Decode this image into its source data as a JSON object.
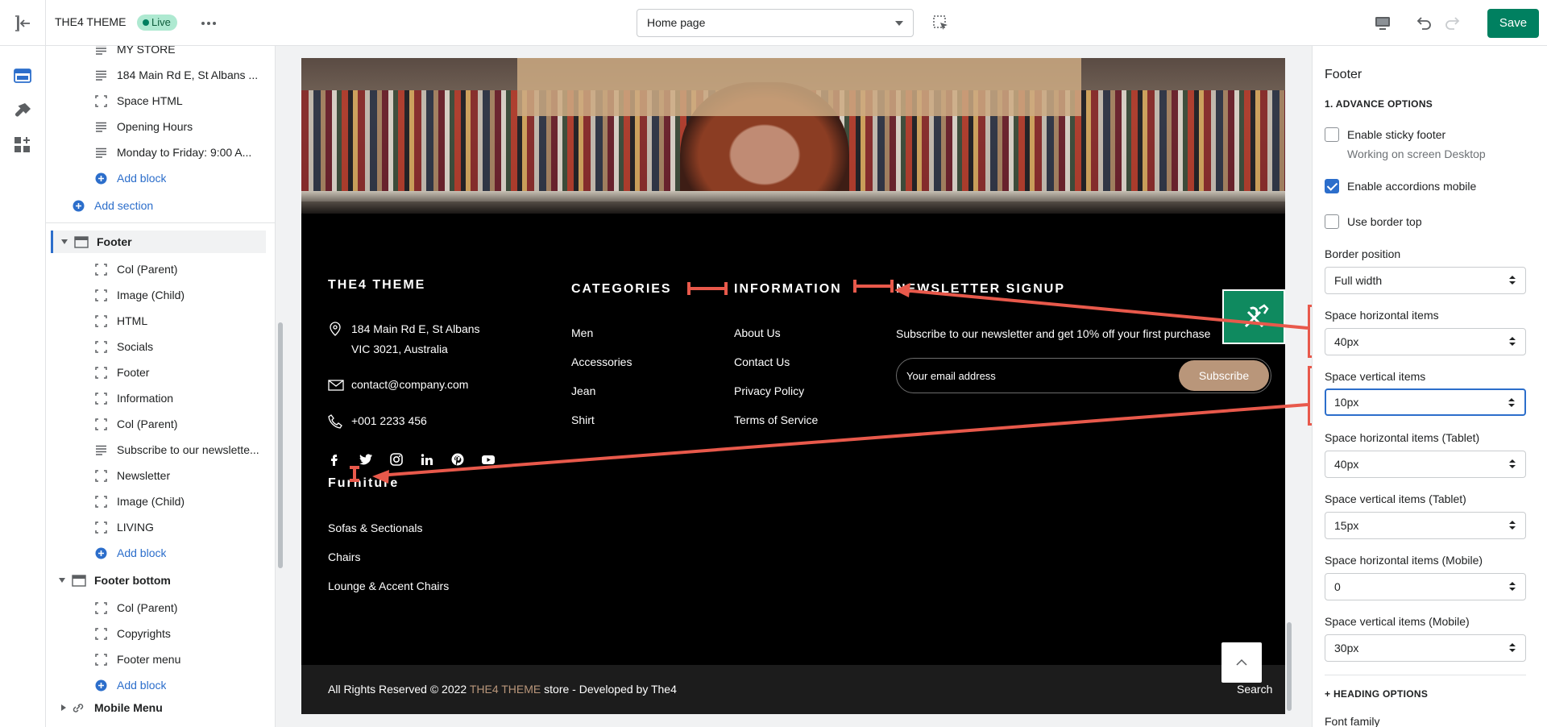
{
  "topbar": {
    "theme_name": "THE4 THEME",
    "live_badge": "Live",
    "page_select": "Home page",
    "save_label": "Save"
  },
  "sidebar": {
    "items": [
      {
        "label": "MY STORE",
        "icon": "text-lines-icon"
      },
      {
        "label": "184 Main Rd E, St Albans ...",
        "icon": "text-lines-icon"
      },
      {
        "label": "Space HTML",
        "icon": "block-frame-icon"
      },
      {
        "label": "Opening Hours",
        "icon": "text-lines-icon"
      },
      {
        "label": "Monday to Friday: 9:00 A...",
        "icon": "text-lines-icon"
      }
    ],
    "add_block": "Add block",
    "add_section": "Add section",
    "footer_section": "Footer",
    "footer_items": [
      "Col (Parent)",
      "Image (Child)",
      "HTML",
      "Socials",
      "Footer",
      "Information",
      "Col (Parent)",
      "Subscribe to our newslette...",
      "Newsletter",
      "Image (Child)",
      "LIVING"
    ],
    "footer_items_icons": [
      "block-frame-icon",
      "block-frame-icon",
      "block-frame-icon",
      "block-frame-icon",
      "block-frame-icon",
      "block-frame-icon",
      "block-frame-icon",
      "text-lines-icon",
      "block-frame-icon",
      "block-frame-icon",
      "block-frame-icon"
    ],
    "footer_bottom_section": "Footer bottom",
    "footer_bottom_items": [
      "Col (Parent)",
      "Copyrights",
      "Footer menu"
    ],
    "mobile_menu_section": "Mobile Menu"
  },
  "preview": {
    "brand_heading": "THE4 THEME",
    "address_line1": "184 Main Rd E, St Albans",
    "address_line2": "VIC 3021, Australia",
    "email": "contact@company.com",
    "phone": "+001 2233 456",
    "categories_heading": "CATEGORIES",
    "categories": [
      "Men",
      "Accessories",
      "Jean",
      "Shirt"
    ],
    "information_heading": "INFORMATION",
    "information_links": [
      "About Us",
      "Contact Us",
      "Privacy Policy",
      "Terms of Service"
    ],
    "newsletter_heading": "NEWSLETTER SIGNUP",
    "newsletter_text": "Subscribe to our newsletter and get 10% off your first purchase",
    "email_placeholder": "Your email address",
    "subscribe_label": "Subscribe",
    "furniture_heading": "Furniture",
    "furniture_links": [
      "Sofas & Sectionals",
      "Chairs",
      "Lounge & Accent Chairs"
    ],
    "copyright_prefix": "All Rights Reserved © 2022 ",
    "copyright_brand": "THE4 THEME",
    "copyright_suffix": " store - Developed by The4",
    "search_label": "Search",
    "brand_accent_color": "#b9967a",
    "social_icons": [
      "facebook-icon",
      "twitter-icon",
      "instagram-icon",
      "linkedin-icon",
      "pinterest-icon",
      "youtube-icon"
    ]
  },
  "settings": {
    "title": "Footer",
    "advance_heading": "1. ADVANCE OPTIONS",
    "sticky_label": "Enable sticky footer",
    "sticky_checked": false,
    "sticky_help": "Working on screen Desktop",
    "accordions_label": "Enable accordions mobile",
    "accordions_checked": true,
    "border_top_label": "Use border top",
    "border_top_checked": false,
    "border_position_label": "Border position",
    "border_position_value": "Full width",
    "space_h_label": "Space horizontal items",
    "space_h_value": "40px",
    "space_v_label": "Space vertical items",
    "space_v_value": "10px",
    "space_h_tablet_label": "Space horizontal items (Tablet)",
    "space_h_tablet_value": "40px",
    "space_v_tablet_label": "Space vertical items (Tablet)",
    "space_v_tablet_value": "15px",
    "space_h_mobile_label": "Space horizontal items (Mobile)",
    "space_h_mobile_value": "0",
    "space_v_mobile_label": "Space vertical items (Mobile)",
    "space_v_mobile_value": "30px",
    "heading_options": "+ HEADING OPTIONS",
    "font_family_label": "Font family"
  },
  "colors": {
    "primary_green": "#008060",
    "selection_blue": "#2c6ecb",
    "annotation_red": "#e8594b"
  }
}
